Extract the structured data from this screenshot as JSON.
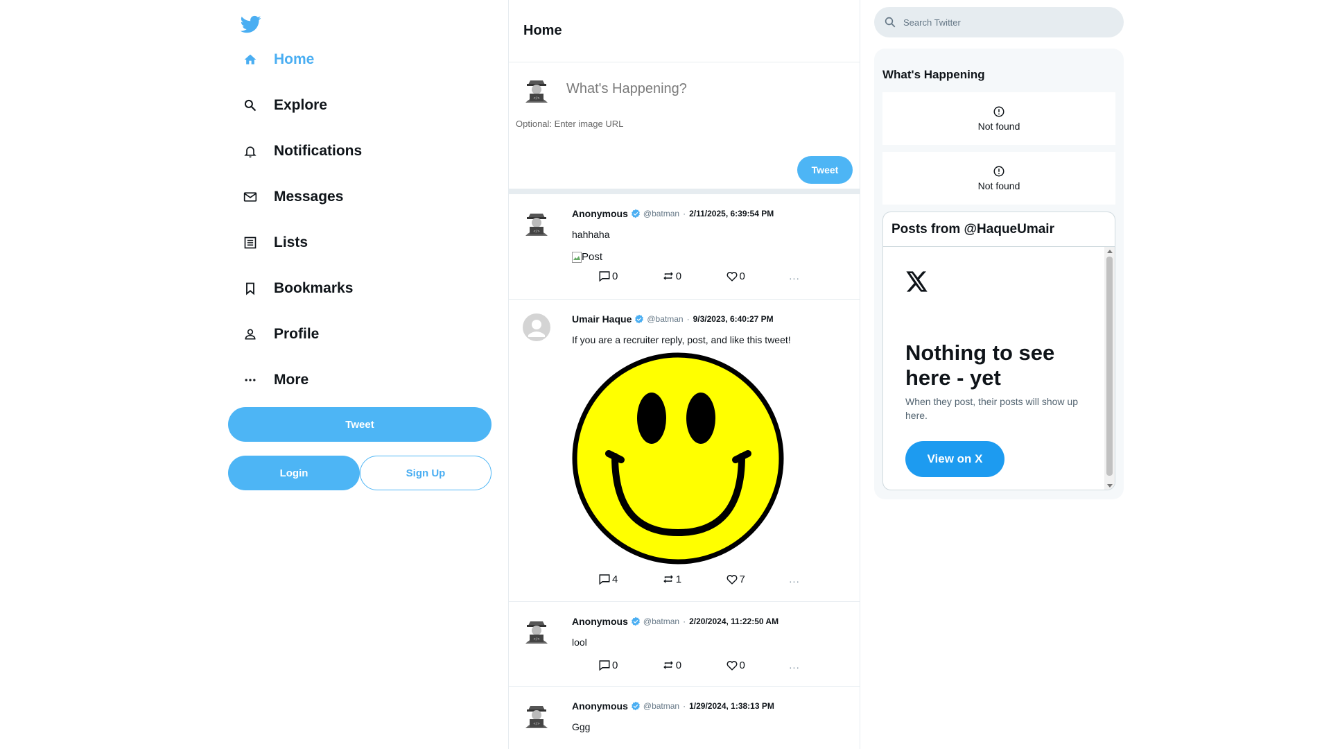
{
  "colors": {
    "accent": "#4db5f5",
    "border": "#e6ecf0",
    "x_blue": "#1d9bf0"
  },
  "sidebar": {
    "logo_icon": "twitter-bird-icon",
    "items": [
      {
        "label": "Home",
        "icon": "home-icon",
        "active": true
      },
      {
        "label": "Explore",
        "icon": "search-icon"
      },
      {
        "label": "Notifications",
        "icon": "bell-icon"
      },
      {
        "label": "Messages",
        "icon": "mail-icon"
      },
      {
        "label": "Lists",
        "icon": "list-icon"
      },
      {
        "label": "Bookmarks",
        "icon": "bookmark-icon"
      },
      {
        "label": "Profile",
        "icon": "person-icon"
      },
      {
        "label": "More",
        "icon": "more-dots-icon"
      }
    ],
    "tweet_label": "Tweet",
    "login_label": "Login",
    "signup_label": "Sign Up"
  },
  "feed": {
    "title": "Home",
    "composer": {
      "placeholder": "What's Happening?",
      "image_url_placeholder": "Optional: Enter image URL",
      "tweet_label": "Tweet"
    },
    "tweets": [
      {
        "name": "Anonymous",
        "handle": "@batman",
        "sep": "·",
        "time": "2/11/2025, 6:39:54 PM",
        "text": "hahhaha",
        "image_alt": "Post",
        "replies": "0",
        "retweets": "0",
        "likes": "0",
        "more": "..."
      },
      {
        "name": "Umair Haque",
        "handle": "@batman",
        "sep": "·",
        "time": "9/3/2023, 6:40:27 PM",
        "text": "If you are a recruiter reply, post, and like this tweet!",
        "replies": "4",
        "retweets": "1",
        "likes": "7",
        "more": "..."
      },
      {
        "name": "Anonymous",
        "handle": "@batman",
        "sep": "·",
        "time": "2/20/2024, 11:22:50 AM",
        "text": "lool",
        "replies": "0",
        "retweets": "0",
        "likes": "0",
        "more": "..."
      },
      {
        "name": "Anonymous",
        "handle": "@batman",
        "sep": "·",
        "time": "1/29/2024, 1:38:13 PM",
        "text": "Ggg"
      }
    ]
  },
  "right": {
    "search_placeholder": "Search Twitter",
    "happening_title": "What's Happening",
    "not_found_1": "Not found",
    "not_found_2": "Not found",
    "embed": {
      "title": "Posts from @HaqueUmair",
      "heading": "Nothing to see here - yet",
      "subtext": "When they post, their posts will show up here.",
      "button": "View on X"
    }
  }
}
